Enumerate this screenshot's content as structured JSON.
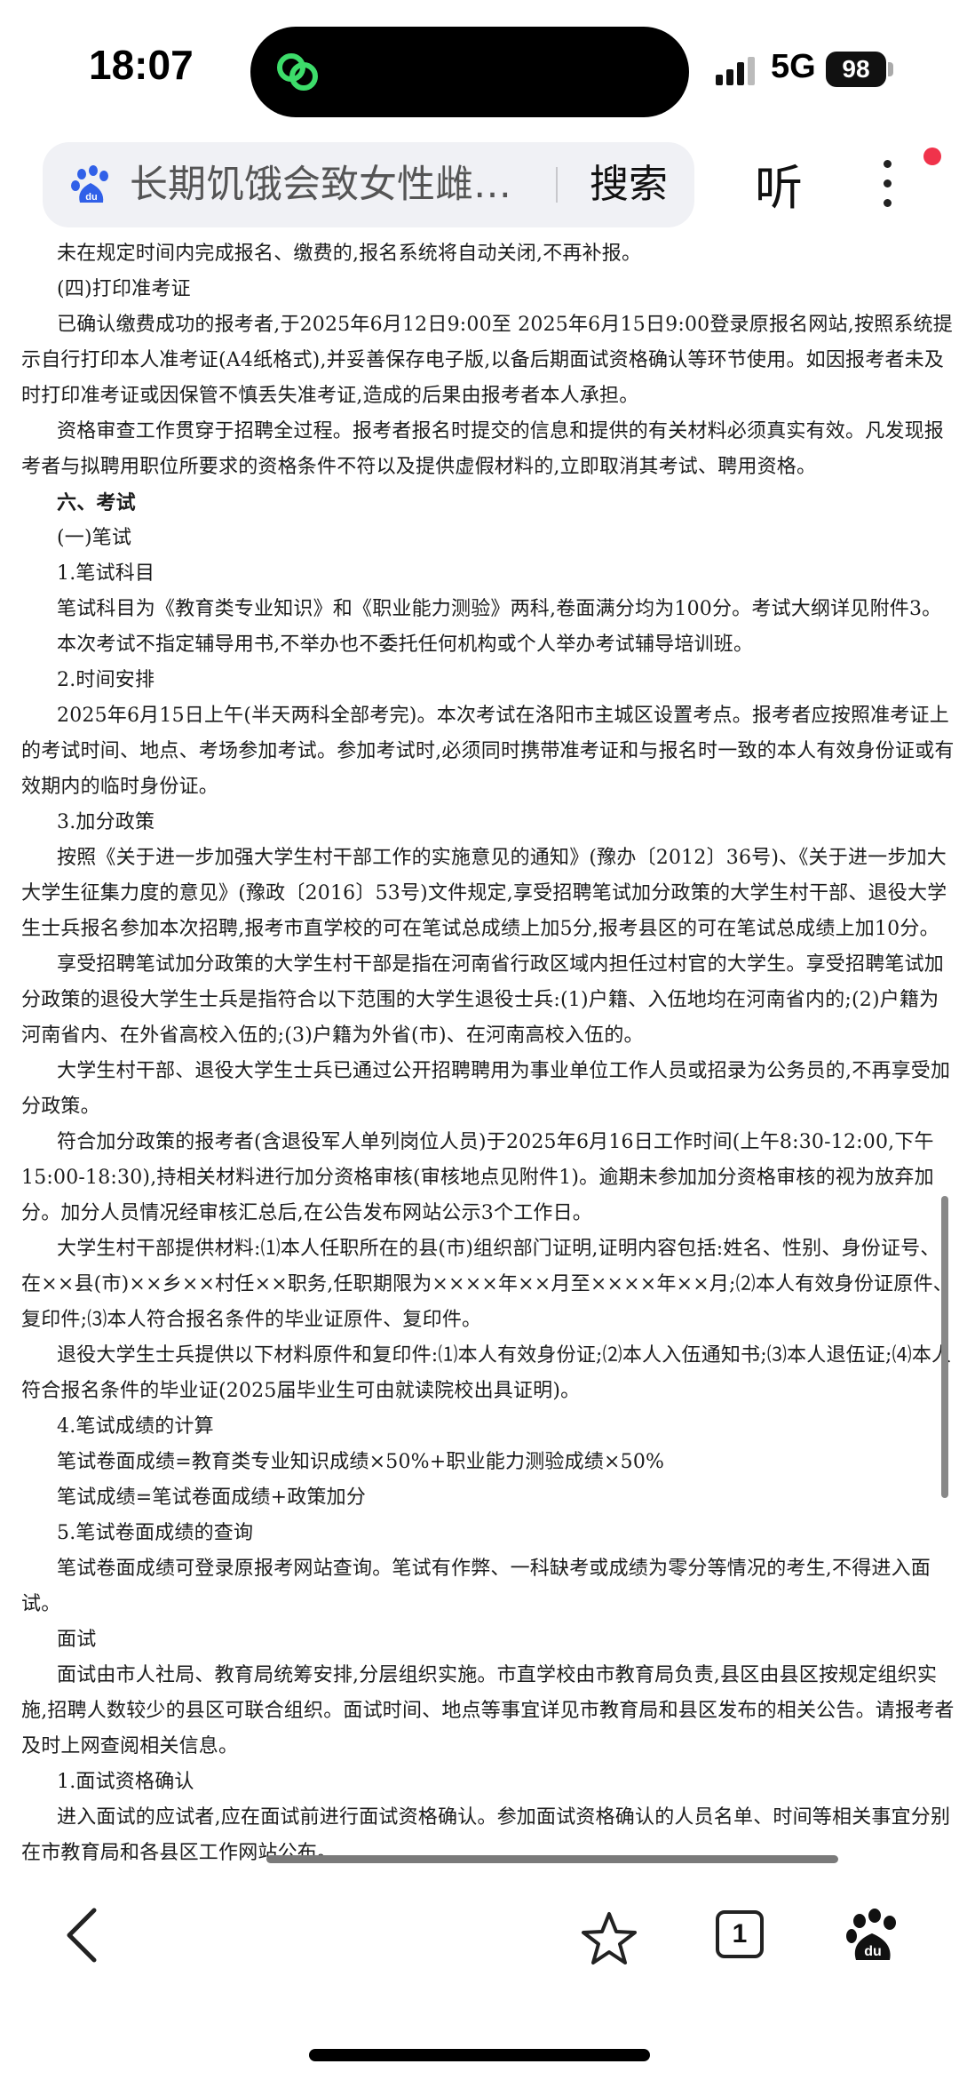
{
  "status_bar": {
    "time": "18:07",
    "network": "5G",
    "battery": "98"
  },
  "header": {
    "search_query": "长期饥饿会致女性雌…",
    "search_button": "搜索",
    "listen_button": "听"
  },
  "document": {
    "paragraphs": [
      "未在规定时间内完成报名、缴费的,报名系统将自动关闭,不再补报。",
      "(四)打印准考证",
      "已确认缴费成功的报考者,于2025年6月12日9:00至 2025年6月15日9:00登录原报名网站,按照系统提示自行打印本人准考证(A4纸格式),并妥善保存电子版,以备后期面试资格确认等环节使用。如因报考者未及时打印准考证或因保管不慎丢失准考证,造成的后果由报考者本人承担。",
      "资格审查工作贯穿于招聘全过程。报考者报名时提交的信息和提供的有关材料必须真实有效。凡发现报考者与拟聘用职位所要求的资格条件不符以及提供虚假材料的,立即取消其考试、聘用资格。",
      "六、考试",
      "(一)笔试",
      "1.笔试科目",
      "笔试科目为《教育类专业知识》和《职业能力测验》两科,卷面满分均为100分。考试大纲详见附件3。",
      "本次考试不指定辅导用书,不举办也不委托任何机构或个人举办考试辅导培训班。",
      "2.时间安排",
      "2025年6月15日上午(半天两科全部考完)。本次考试在洛阳市主城区设置考点。报考者应按照准考证上的考试时间、地点、考场参加考试。参加考试时,必须同时携带准考证和与报名时一致的本人有效身份证或有效期内的临时身份证。",
      "3.加分政策",
      "按照《关于进一步加强大学生村干部工作的实施意见的通知》(豫办〔2012〕36号)、《关于进一步加大大学生征集力度的意见》(豫政〔2016〕53号)文件规定,享受招聘笔试加分政策的大学生村干部、退役大学生士兵报名参加本次招聘,报考市直学校的可在笔试总成绩上加5分,报考县区的可在笔试总成绩上加10分。",
      "享受招聘笔试加分政策的大学生村干部是指在河南省行政区域内担任过村官的大学生。享受招聘笔试加分政策的退役大学生士兵是指符合以下范围的大学生退役士兵:(1)户籍、入伍地均在河南省内的;(2)户籍为河南省内、在外省高校入伍的;(3)户籍为外省(市)、在河南高校入伍的。",
      "大学生村干部、退役大学生士兵已通过公开招聘聘用为事业单位工作人员或招录为公务员的,不再享受加分政策。",
      "符合加分政策的报考者(含退役军人单列岗位人员)于2025年6月16日工作时间(上午8:30-12:00,下午15:00-18:30),持相关材料进行加分资格审核(审核地点见附件1)。逾期未参加加分资格审核的视为放弃加分。加分人员情况经审核汇总后,在公告发布网站公示3个工作日。",
      "大学生村干部提供材料:⑴本人任职所在的县(市)组织部门证明,证明内容包括:姓名、性别、身份证号、在××县(市)××乡××村任××职务,任职期限为××××年××月至××××年××月;⑵本人有效身份证原件、复印件;⑶本人符合报名条件的毕业证原件、复印件。",
      "退役大学生士兵提供以下材料原件和复印件:⑴本人有效身份证;⑵本人入伍通知书;⑶本人退伍证;⑷本人符合报名条件的毕业证(2025届毕业生可由就读院校出具证明)。",
      "4.笔试成绩的计算",
      "笔试卷面成绩=教育类专业知识成绩×50%+职业能力测验成绩×50%",
      "笔试成绩=笔试卷面成绩+政策加分",
      "5.笔试卷面成绩的查询",
      "笔试卷面成绩可登录原报考网站查询。笔试有作弊、一科缺考或成绩为零分等情况的考生,不得进入面试。",
      "面试",
      "面试由市人社局、教育局统筹安排,分层组织实施。市直学校由市教育局负责,县区由县区按规定组织实施,招聘人数较少的县区可联合组织。面试时间、地点等事宜详见市教育局和县区发布的相关公告。请报考者及时上网查阅相关信息。",
      "1.面试资格确认",
      "进入面试的应试者,应在面试前进行面试资格确认。参加面试资格确认的人员名单、时间等相关事宜分别在市教育局和各县区工作网站公布。"
    ]
  },
  "bottom_bar": {
    "tab_count": "1"
  },
  "colors": {
    "baidu_blue": "#3060e8",
    "notification_red": "#f0334b",
    "wechat_green": "#3ddc6a"
  }
}
